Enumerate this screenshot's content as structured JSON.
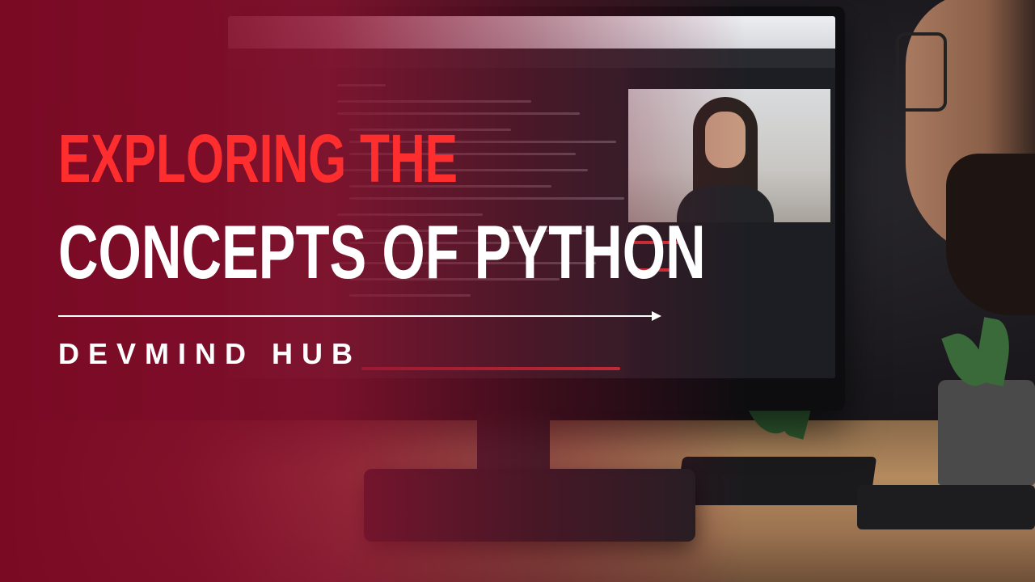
{
  "headline": {
    "line1": "EXPLORING THE",
    "line2": "CONCEPTS OF PYTHON"
  },
  "brand": {
    "name": "DEVMIND HUB"
  },
  "colors": {
    "accent_red": "#ff2e2e",
    "overlay_crimson": "#7a0a24",
    "text_white": "#ffffff"
  },
  "icons": {
    "divider_arrow": "arrow-right-icon"
  }
}
